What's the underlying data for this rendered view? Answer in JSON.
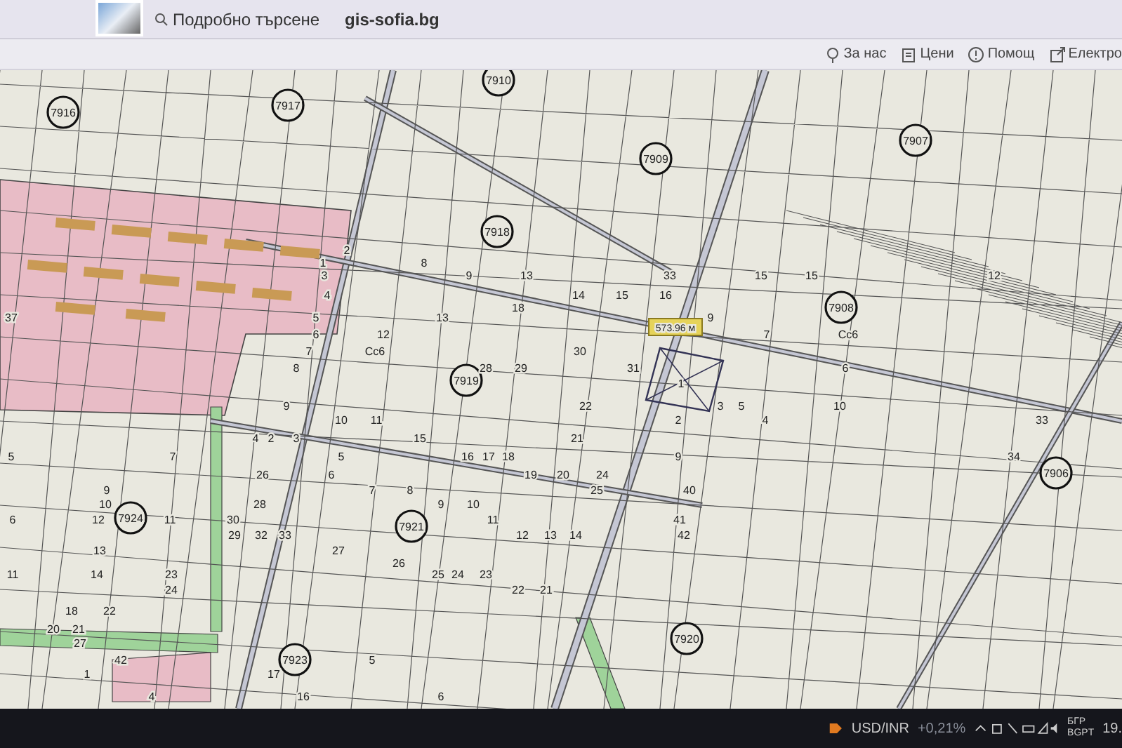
{
  "header": {
    "search_label": "Подробно търсене",
    "site": "gis-sofia.bg"
  },
  "toolbar": [
    {
      "label": "За нас",
      "kind": "pin"
    },
    {
      "label": "Цени",
      "kind": "doc"
    },
    {
      "label": "Помощ",
      "kind": "help"
    },
    {
      "label": "Електро",
      "kind": "external"
    }
  ],
  "map": {
    "blocks": [
      "7910",
      "7916",
      "7917",
      "7907",
      "7909",
      "7918",
      "7908",
      "7919",
      "7906",
      "7924",
      "7921",
      "7920",
      "7923"
    ],
    "parcels": [
      "2",
      "1",
      "8",
      "3",
      "9",
      "13",
      "33",
      "15",
      "15",
      "12",
      "4",
      "14",
      "15",
      "16",
      "18",
      "37",
      "5",
      "13",
      "9",
      "6",
      "12",
      "7",
      "Сс6",
      "7",
      "Сс6",
      "30",
      "8",
      "28",
      "29",
      "31",
      "6",
      "1",
      "9",
      "22",
      "3",
      "5",
      "10",
      "10",
      "11",
      "2",
      "4",
      "33",
      "4",
      "2",
      "3",
      "15",
      "21",
      "5",
      "7",
      "5",
      "16",
      "17",
      "18",
      "9",
      "34",
      "26",
      "6",
      "19",
      "20",
      "24",
      "9",
      "7",
      "8",
      "25",
      "40",
      "10",
      "28",
      "9",
      "10",
      "6",
      "12",
      "11",
      "30",
      "11",
      "41",
      "29",
      "32",
      "33",
      "12",
      "13",
      "14",
      "42",
      "13",
      "27",
      "26",
      "11",
      "14",
      "23",
      "25",
      "24",
      "23",
      "24",
      "22",
      "21",
      "18",
      "22",
      "20",
      "21",
      "27",
      "42",
      "5",
      "1",
      "17",
      "4",
      "16",
      "6"
    ],
    "measurement": "573.96 м"
  },
  "taskbar": {
    "ticker": "USD/INR",
    "change": "+0,21%",
    "language": "БГР",
    "layout": "BGPT",
    "clock": "19."
  }
}
